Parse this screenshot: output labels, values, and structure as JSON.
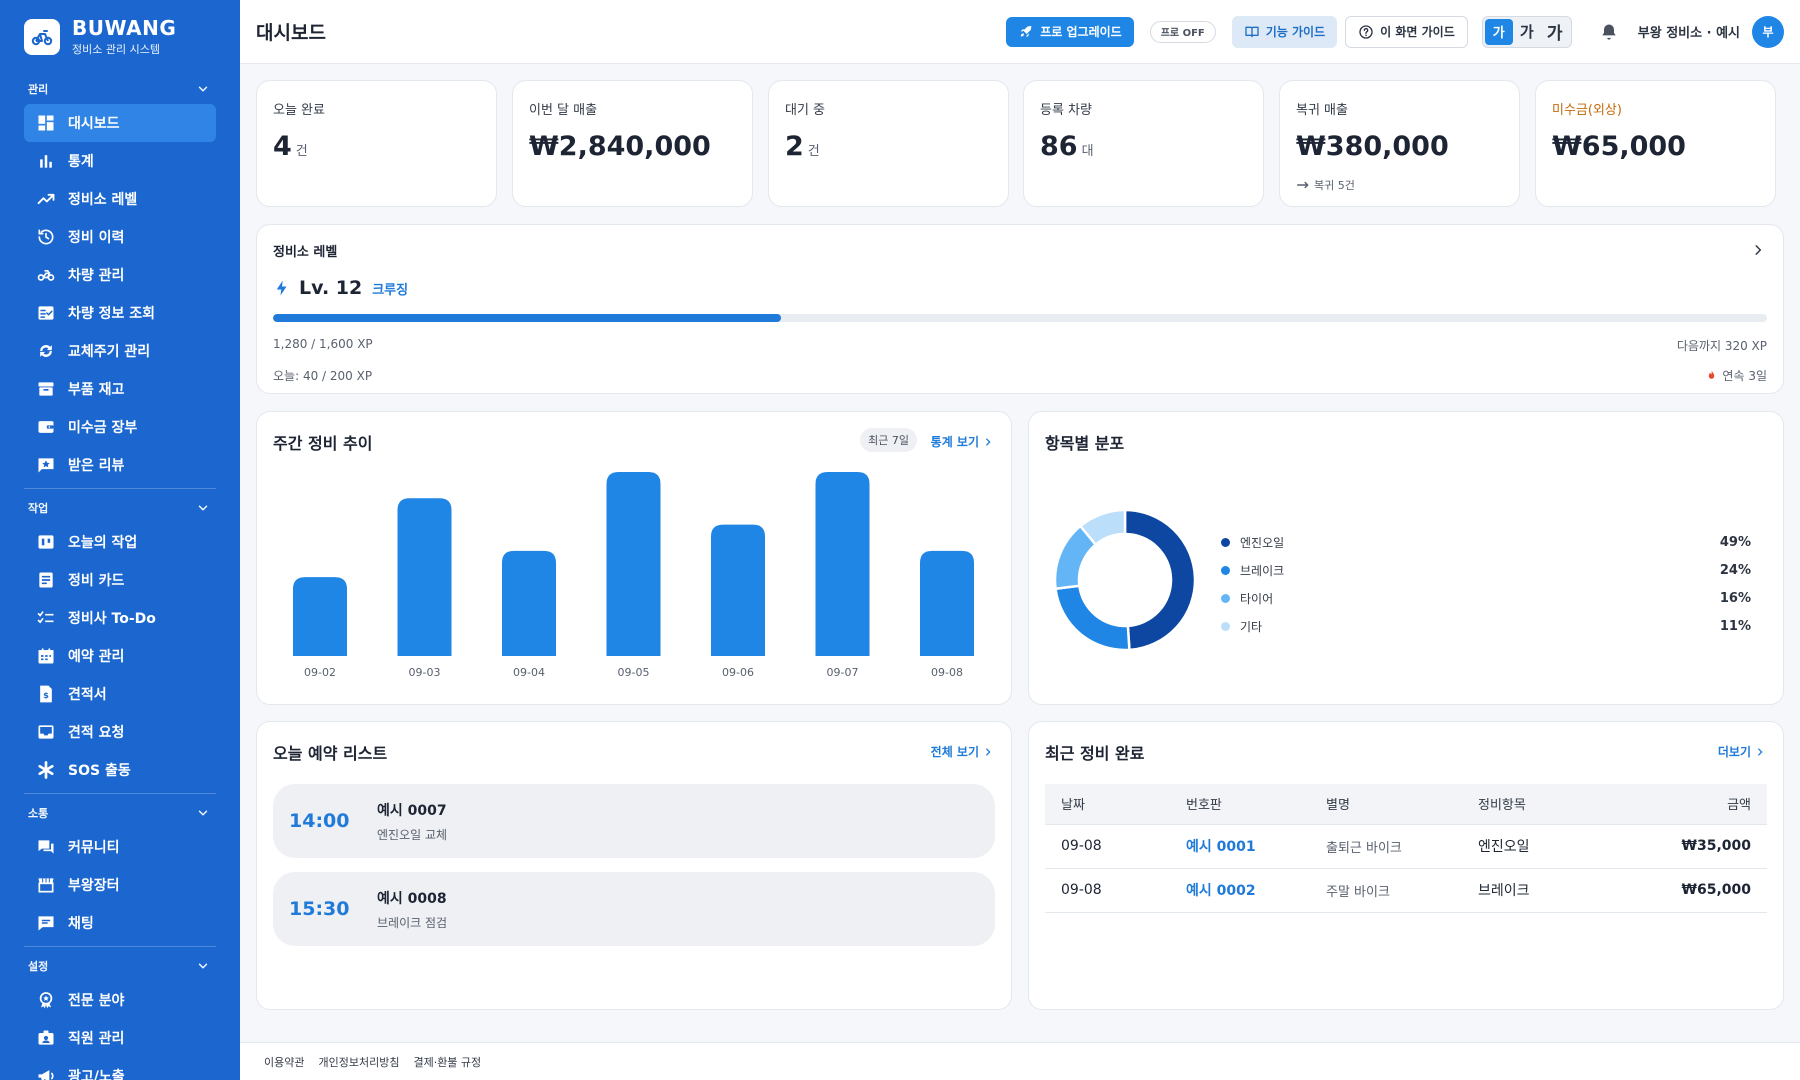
{
  "brand": {
    "name": "BUWANG",
    "subtitle": "정비소 관리 시스템"
  },
  "sidebar": {
    "sections": [
      {
        "title": "관리",
        "items": [
          {
            "label": "대시보드",
            "icon": "dashboard-icon",
            "active": true
          },
          {
            "label": "통계",
            "icon": "bar-chart-icon"
          },
          {
            "label": "정비소 레벨",
            "icon": "trending-up-icon"
          },
          {
            "label": "정비 이력",
            "icon": "history-icon"
          },
          {
            "label": "차량 관리",
            "icon": "motorcycle-icon"
          },
          {
            "label": "차량 정보 조회",
            "icon": "fact-check-icon"
          },
          {
            "label": "교체주기 관리",
            "icon": "cycle-icon"
          },
          {
            "label": "부품 재고",
            "icon": "inventory-icon"
          },
          {
            "label": "미수금 장부",
            "icon": "wallet-icon"
          },
          {
            "label": "받은 리뷰",
            "icon": "review-icon"
          }
        ]
      },
      {
        "title": "작업",
        "items": [
          {
            "label": "오늘의 작업",
            "icon": "today-icon"
          },
          {
            "label": "정비 카드",
            "icon": "card-icon"
          },
          {
            "label": "정비사 To-Do",
            "icon": "checklist-icon"
          },
          {
            "label": "예약 관리",
            "icon": "calendar-icon"
          },
          {
            "label": "견적서",
            "icon": "estimate-doc-icon"
          },
          {
            "label": "견적 요청",
            "icon": "inbox-icon"
          },
          {
            "label": "SOS 출동",
            "icon": "sos-icon"
          }
        ]
      },
      {
        "title": "소통",
        "items": [
          {
            "label": "커뮤니티",
            "icon": "forum-icon"
          },
          {
            "label": "부왕장터",
            "icon": "store-icon"
          },
          {
            "label": "채팅",
            "icon": "chat-icon"
          }
        ]
      },
      {
        "title": "설정",
        "items": [
          {
            "label": "전문 분야",
            "icon": "badge-icon"
          },
          {
            "label": "직원 관리",
            "icon": "staff-icon"
          },
          {
            "label": "광고/노출",
            "icon": "megaphone-icon"
          }
        ]
      }
    ]
  },
  "topbar": {
    "title": "대시보드",
    "pro_upgrade": "프로 업그레이드",
    "pro_status": "프로 OFF",
    "feature_guide": "기능 가이드",
    "screen_guide": "이 화면 가이드",
    "font_sizes": [
      "가",
      "가",
      "가"
    ],
    "user_name": "부왕 정비소 · 예시",
    "avatar": "부"
  },
  "kpis": [
    {
      "label": "오늘 완료",
      "value": "4",
      "unit": "건"
    },
    {
      "label": "이번 달 매출",
      "value": "₩2,840,000",
      "unit": ""
    },
    {
      "label": "대기 중",
      "value": "2",
      "unit": "건"
    },
    {
      "label": "등록 차량",
      "value": "86",
      "unit": "대"
    },
    {
      "label": "복귀 매출",
      "value": "₩380,000",
      "unit": "",
      "sub": "복귀 5건"
    },
    {
      "label": "미수금(외상)",
      "value": "₩65,000",
      "unit": ""
    }
  ],
  "level": {
    "title": "정비소 레벨",
    "level": "Lv. 12",
    "rank": "크루징",
    "xp_text": "1,280 / 1,600 XP",
    "xp_progress": 0.34,
    "next_text": "다음까지 320 XP",
    "today_text": "오늘: 40 / 200 XP",
    "streak_text": "연속 3일"
  },
  "weekly": {
    "title": "주간 정비 추이",
    "range": "최근 7일",
    "link": "통계 보기"
  },
  "chart_data": {
    "type": "bar",
    "categories": [
      "09-02",
      "09-03",
      "09-04",
      "09-05",
      "09-06",
      "09-07",
      "09-08"
    ],
    "values": [
      3,
      6,
      4,
      7,
      5,
      7,
      4
    ],
    "ylim": [
      0,
      7
    ],
    "color": "#1f86e5"
  },
  "distribution": {
    "title": "항목별 분포",
    "items": [
      {
        "name": "엔진오일",
        "pct": "49%",
        "value": 49,
        "color": "#0e47a1"
      },
      {
        "name": "브레이크",
        "pct": "24%",
        "value": 24,
        "color": "#1f86e5"
      },
      {
        "name": "타이어",
        "pct": "16%",
        "value": 16,
        "color": "#64b5f6"
      },
      {
        "name": "기타",
        "pct": "11%",
        "value": 11,
        "color": "#bbdefb"
      }
    ]
  },
  "reservations": {
    "title": "오늘 예약 리스트",
    "link": "전체 보기",
    "items": [
      {
        "time": "14:00",
        "name": "예시 0007",
        "desc": "엔진오일 교체"
      },
      {
        "time": "15:30",
        "name": "예시 0008",
        "desc": "브레이크 점검"
      }
    ]
  },
  "recent": {
    "title": "최근 정비 완료",
    "link": "더보기",
    "columns": [
      "날짜",
      "번호판",
      "별명",
      "정비항목",
      "금액"
    ],
    "rows": [
      [
        "09-08",
        "예시 0001",
        "출퇴근 바이크",
        "엔진오일",
        "₩35,000"
      ],
      [
        "09-08",
        "예시 0002",
        "주말 바이크",
        "브레이크",
        "₩65,000"
      ]
    ]
  },
  "footer": {
    "links": [
      "이용약관",
      "개인정보처리방침",
      "결제·환불 규정"
    ]
  }
}
